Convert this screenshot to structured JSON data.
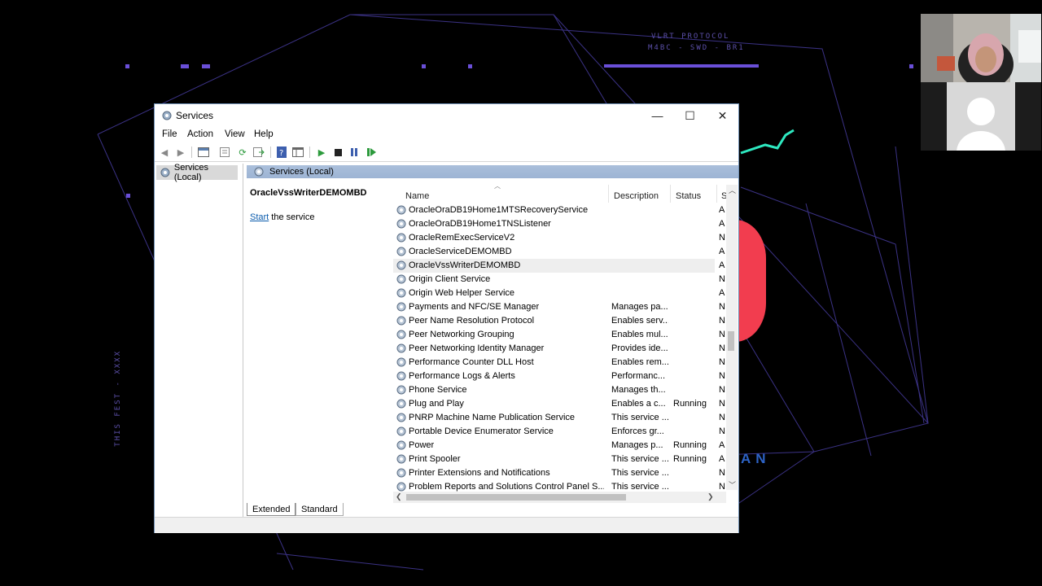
{
  "background": {
    "corner_text_line1": "VLRT PROTOCOL",
    "corner_text_line2": "M4BC - SWD - BR1",
    "vertical_text": "THIS FEST - XXXX",
    "big_text": "AN",
    "accent_purple": "#6a4fd8",
    "accent_red": "#f23d4f",
    "accent_teal": "#2ee8c0"
  },
  "window": {
    "title": "Services",
    "minimize_glyph": "—",
    "maximize_glyph": "☐",
    "close_glyph": "✕"
  },
  "menu": {
    "file": "File",
    "action": "Action",
    "view": "View",
    "help": "Help"
  },
  "tree": {
    "root_label": "Services (Local)"
  },
  "pane_header": "Services (Local)",
  "detail": {
    "selected_name": "OracleVssWriterDEMOMBD",
    "start_link": "Start",
    "start_suffix": " the service"
  },
  "columns": {
    "name": "Name",
    "description": "Description",
    "status": "Status",
    "startup": "S"
  },
  "rows": [
    {
      "name": "OracleOraDB19Home1MTSRecoveryService",
      "description": "",
      "status": "",
      "startup": "A"
    },
    {
      "name": "OracleOraDB19Home1TNSListener",
      "description": "",
      "status": "",
      "startup": "A"
    },
    {
      "name": "OracleRemExecServiceV2",
      "description": "",
      "status": "",
      "startup": "N"
    },
    {
      "name": "OracleServiceDEMOMBD",
      "description": "",
      "status": "",
      "startup": "A"
    },
    {
      "name": "OracleVssWriterDEMOMBD",
      "description": "",
      "status": "",
      "startup": "A"
    },
    {
      "name": "Origin Client Service",
      "description": "",
      "status": "",
      "startup": "N"
    },
    {
      "name": "Origin Web Helper Service",
      "description": "",
      "status": "",
      "startup": "A"
    },
    {
      "name": "Payments and NFC/SE Manager",
      "description": "Manages pa...",
      "status": "",
      "startup": "N"
    },
    {
      "name": "Peer Name Resolution Protocol",
      "description": "Enables serv...",
      "status": "",
      "startup": "N"
    },
    {
      "name": "Peer Networking Grouping",
      "description": "Enables mul...",
      "status": "",
      "startup": "N"
    },
    {
      "name": "Peer Networking Identity Manager",
      "description": "Provides ide...",
      "status": "",
      "startup": "N"
    },
    {
      "name": "Performance Counter DLL Host",
      "description": "Enables rem...",
      "status": "",
      "startup": "N"
    },
    {
      "name": "Performance Logs & Alerts",
      "description": "Performanc...",
      "status": "",
      "startup": "N"
    },
    {
      "name": "Phone Service",
      "description": "Manages th...",
      "status": "",
      "startup": "N"
    },
    {
      "name": "Plug and Play",
      "description": "Enables a c...",
      "status": "Running",
      "startup": "N"
    },
    {
      "name": "PNRP Machine Name Publication Service",
      "description": "This service ...",
      "status": "",
      "startup": "N"
    },
    {
      "name": "Portable Device Enumerator Service",
      "description": "Enforces gr...",
      "status": "",
      "startup": "N"
    },
    {
      "name": "Power",
      "description": "Manages p...",
      "status": "Running",
      "startup": "A"
    },
    {
      "name": "Print Spooler",
      "description": "This service ...",
      "status": "Running",
      "startup": "A"
    },
    {
      "name": "Printer Extensions and Notifications",
      "description": "This service ...",
      "status": "",
      "startup": "N"
    },
    {
      "name": "Problem Reports and Solutions Control Panel S...",
      "description": "This service ...",
      "status": "",
      "startup": "N"
    }
  ],
  "selected_row_index": 4,
  "tabs": {
    "extended": "Extended",
    "standard": "Standard"
  },
  "icons": {
    "title": "gear-icon",
    "row": "gear-icon",
    "toolbar": [
      "back-arrow-icon",
      "forward-arrow-icon",
      "show-tree-icon",
      "properties-icon",
      "refresh-icon",
      "export-list-icon",
      "help-icon",
      "console-icon",
      "play-icon",
      "stop-icon",
      "pause-icon",
      "resume-icon"
    ]
  }
}
